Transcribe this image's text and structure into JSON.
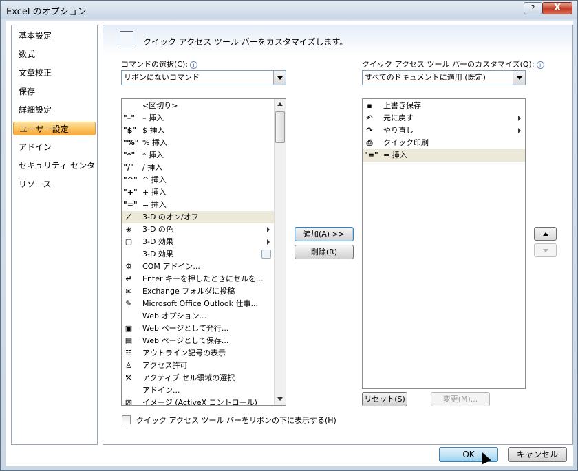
{
  "window": {
    "title": "Excel のオプション",
    "help": "?",
    "close": "X"
  },
  "nav": {
    "items": [
      {
        "label": "基本設定"
      },
      {
        "label": "数式"
      },
      {
        "label": "文章校正"
      },
      {
        "label": "保存"
      },
      {
        "label": "詳細設定"
      },
      {
        "label": "ユーザー設定",
        "selected": true
      },
      {
        "label": "アドイン"
      },
      {
        "label": "セキュリティ センター"
      },
      {
        "label": "リソース"
      }
    ]
  },
  "header": {
    "text": "クイック アクセス ツール バーをカスタマイズします。"
  },
  "left": {
    "label": "コマンドの選択(C):",
    "combo_value": "リボンにないコマンド",
    "items": [
      {
        "icon": "",
        "label": "<区切り>"
      },
      {
        "icon": "\"–\"",
        "label": "– 挿入"
      },
      {
        "icon": "\"$\"",
        "label": "$ 挿入"
      },
      {
        "icon": "\"%\"",
        "label": "% 挿入"
      },
      {
        "icon": "\"*\"",
        "label": "* 挿入"
      },
      {
        "icon": "\"/\"",
        "label": "/ 挿入"
      },
      {
        "icon": "\"^\"",
        "label": "^ 挿入"
      },
      {
        "icon": "\"+\"",
        "label": "+ 挿入"
      },
      {
        "icon": "\"=\"",
        "label": "= 挿入"
      },
      {
        "icon": "⟋",
        "label": "3-D のオン/オフ",
        "highlight": true
      },
      {
        "icon": "◈",
        "label": "3-D の色",
        "submenu": true
      },
      {
        "icon": "▢",
        "label": "3-D 効果",
        "submenu": true
      },
      {
        "icon": "",
        "label": "3-D 効果",
        "dropdown": true
      },
      {
        "icon": "⚙",
        "label": "COM アドイン..."
      },
      {
        "icon": "↵",
        "label": "Enter キーを押したときにセルを..."
      },
      {
        "icon": "✉",
        "label": "Exchange フォルダに投稿"
      },
      {
        "icon": "✎",
        "label": "Microsoft Office Outlook 仕事..."
      },
      {
        "icon": "",
        "label": "Web オプション..."
      },
      {
        "icon": "▣",
        "label": "Web ページとして発行..."
      },
      {
        "icon": "▤",
        "label": "Web ページとして保存..."
      },
      {
        "icon": "☷",
        "label": "アウトライン記号の表示"
      },
      {
        "icon": "♙",
        "label": "アクセス許可"
      },
      {
        "icon": "⤧",
        "label": "アクティブ セル領域の選択"
      },
      {
        "icon": "",
        "label": "アドイン..."
      },
      {
        "icon": "▨",
        "label": "イメージ (ActiveX コントロール)"
      }
    ]
  },
  "right": {
    "label": "クイック アクセス ツール バーのカスタマイズ(Q):",
    "combo_value": "すべてのドキュメントに適用 (既定)",
    "items": [
      {
        "icon": "▪",
        "label": "上書き保存"
      },
      {
        "icon": "↶",
        "label": "元に戻す",
        "submenu": true
      },
      {
        "icon": "↷",
        "label": "やり直し",
        "submenu": true
      },
      {
        "icon": "⎙",
        "label": "クイック印刷"
      },
      {
        "icon": "\"=\"",
        "label": "= 挿入",
        "highlight": true
      }
    ]
  },
  "buttons": {
    "add": "追加(A) >>",
    "remove": "削除(R)",
    "reset": "リセット(S)",
    "modify": "変更(M)..."
  },
  "checkbox": {
    "label": "クイック アクセス ツール バーをリボンの下に表示する(H)",
    "checked": false
  },
  "footer": {
    "ok": "OK",
    "cancel": "キャンセル"
  }
}
